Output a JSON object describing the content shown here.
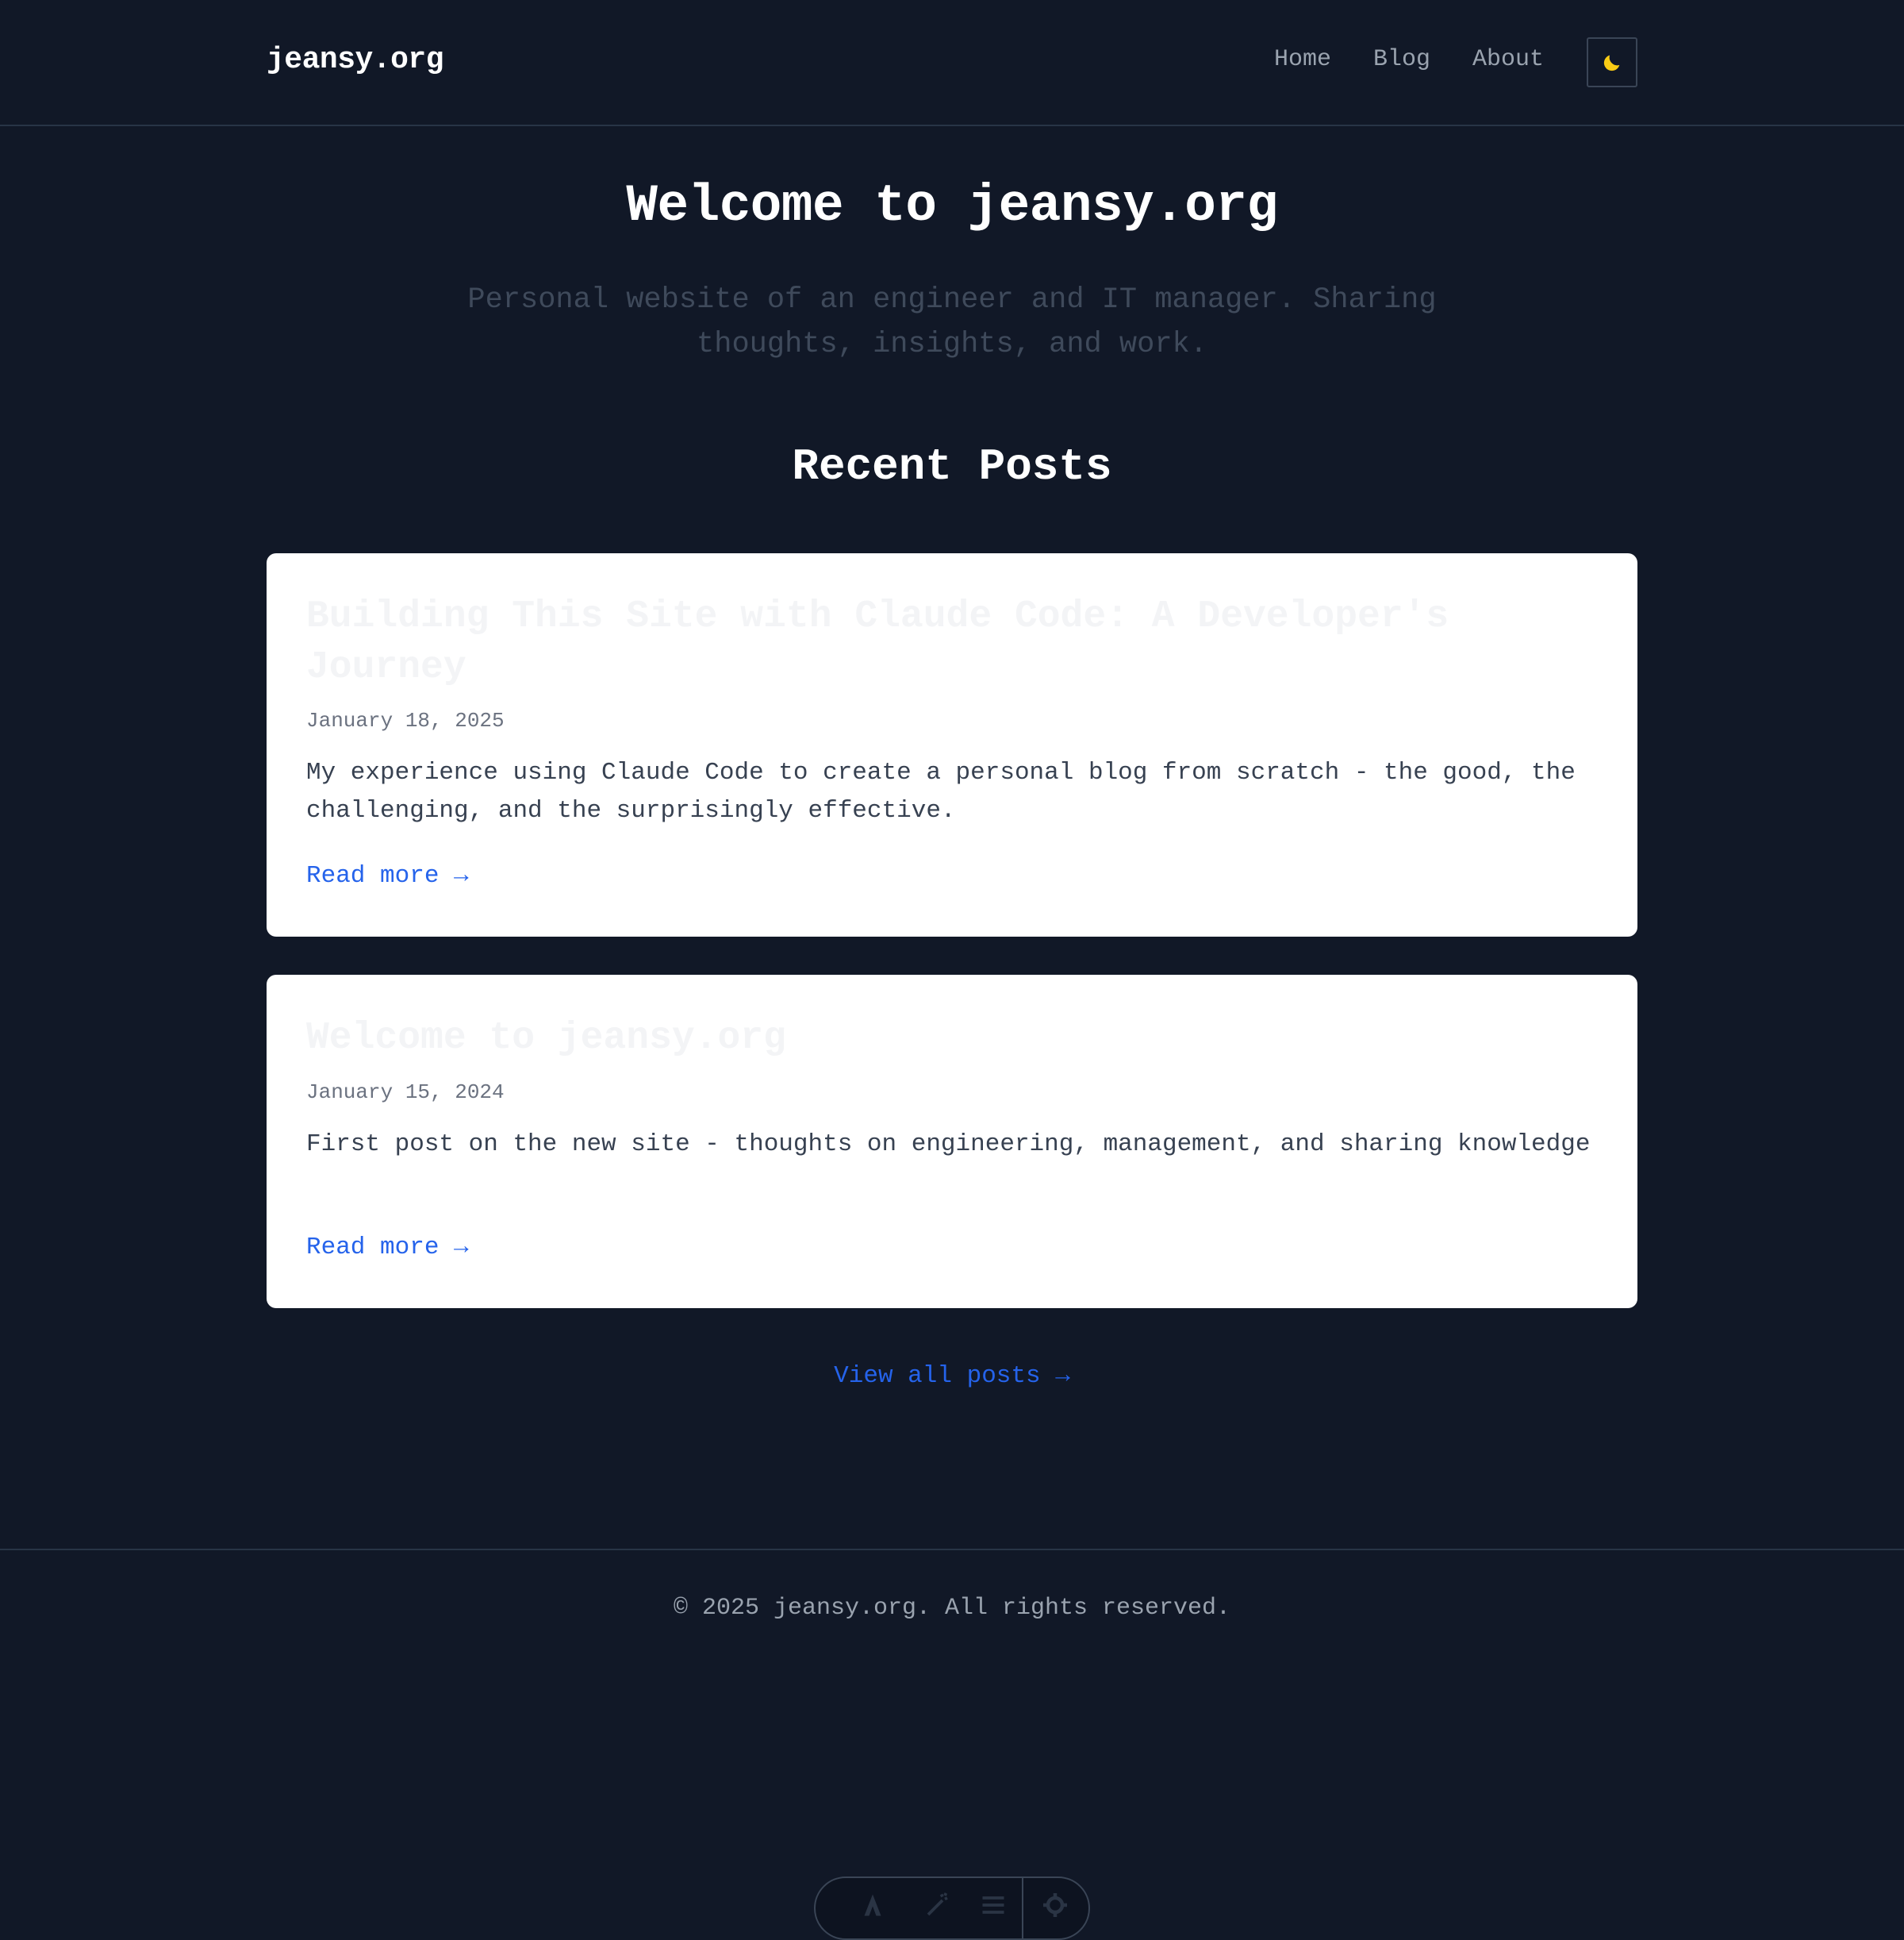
{
  "header": {
    "logo": "jeansy.org",
    "nav": [
      {
        "label": "Home"
      },
      {
        "label": "Blog"
      },
      {
        "label": "About"
      }
    ],
    "theme_toggle_icon": "moon-icon"
  },
  "hero": {
    "title": "Welcome to jeansy.org",
    "subtitle": "Personal website of an engineer and IT manager. Sharing thoughts, insights, and work."
  },
  "recent_posts": {
    "heading": "Recent Posts",
    "posts": [
      {
        "title": "Building This Site with Claude Code: A Developer's Journey",
        "date": "January 18, 2025",
        "excerpt": "My experience using Claude Code to create a personal blog from scratch - the good, the challenging, and the surprisingly effective.",
        "read_more": "Read more →"
      },
      {
        "title": "Welcome to jeansy.org",
        "date": "January 15, 2024",
        "excerpt": "First post on the new site - thoughts on engineering, management, and sharing knowledge",
        "read_more": "Read more →"
      }
    ],
    "view_all": "View all posts →"
  },
  "footer": {
    "copyright": "© 2025 jeansy.org. All rights reserved."
  },
  "dev_toolbar": {
    "icons": [
      "astro-logo-icon",
      "wand-icon",
      "menu-icon",
      "gear-icon"
    ]
  },
  "colors": {
    "background": "#111827",
    "card": "#ffffff",
    "link": "#2563eb",
    "moon": "#facc15",
    "muted_text": "#9aa3af"
  }
}
